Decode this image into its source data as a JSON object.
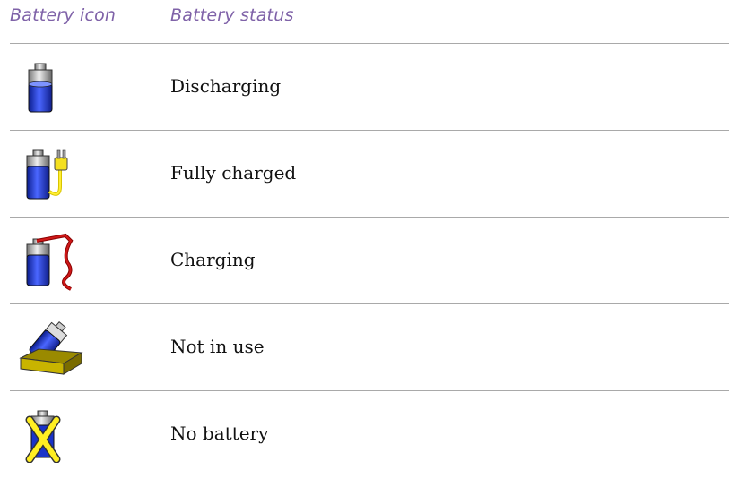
{
  "table": {
    "header": {
      "icon_col": "Battery icon",
      "status_col": "Battery status"
    },
    "rows": [
      {
        "icon": "battery-discharging-icon",
        "status": "Discharging"
      },
      {
        "icon": "battery-fully-charged-icon",
        "status": "Fully charged"
      },
      {
        "icon": "battery-charging-icon",
        "status": "Charging"
      },
      {
        "icon": "battery-not-in-use-icon",
        "status": "Not in use"
      },
      {
        "icon": "no-battery-icon",
        "status": "No battery"
      }
    ]
  },
  "colors": {
    "header_text": "#7f62a8",
    "rule": "#a9a9a9",
    "battery_blue": "#2a3fd0"
  }
}
